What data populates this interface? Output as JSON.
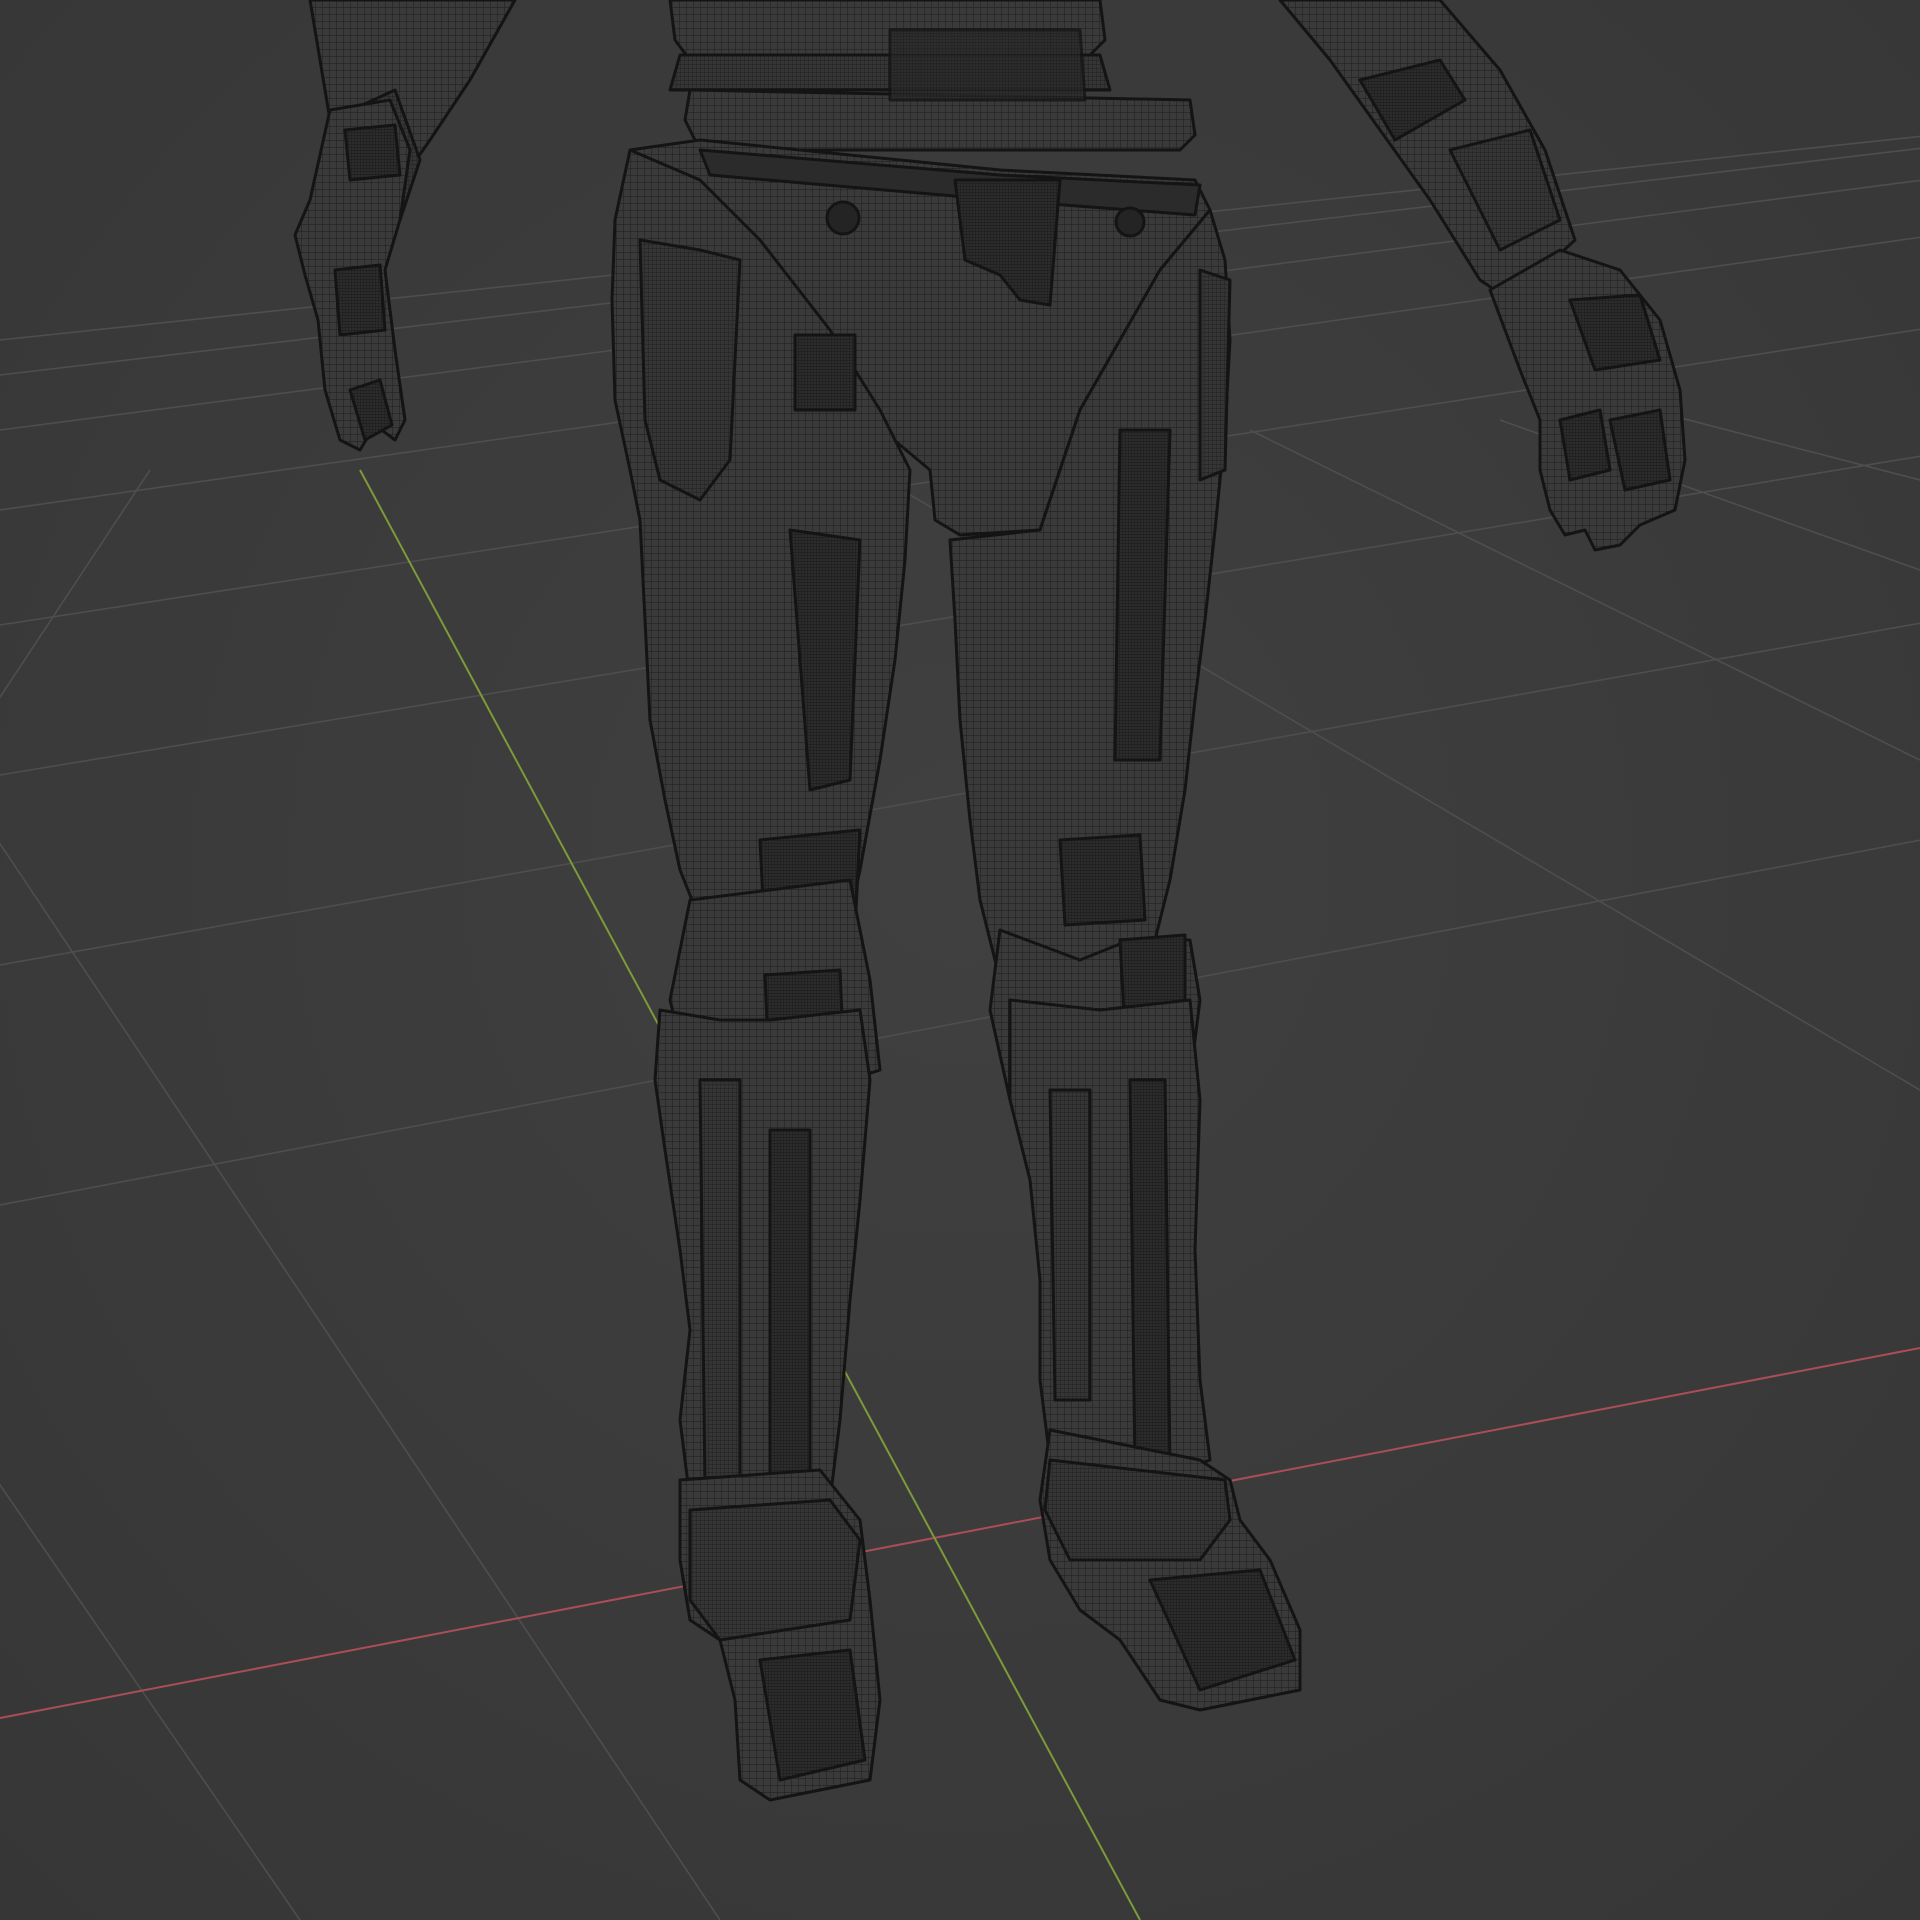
{
  "viewport": {
    "type": "3d-viewport",
    "shading_mode": "wireframe",
    "background_color": "#3b3b3b",
    "grid_color": "#4c4c4c",
    "x_axis_color": "#b4505a",
    "y_axis_color": "#7e9a3c",
    "mesh_fill_color": "#3a3a3a",
    "mesh_wire_color": "#1a1a1a"
  },
  "scene": {
    "object": "robot-character",
    "visible_parts": [
      "left-arm",
      "right-arm",
      "left-hand",
      "right-hand",
      "waist",
      "pelvis",
      "left-leg",
      "right-leg",
      "left-foot",
      "right-foot"
    ]
  }
}
